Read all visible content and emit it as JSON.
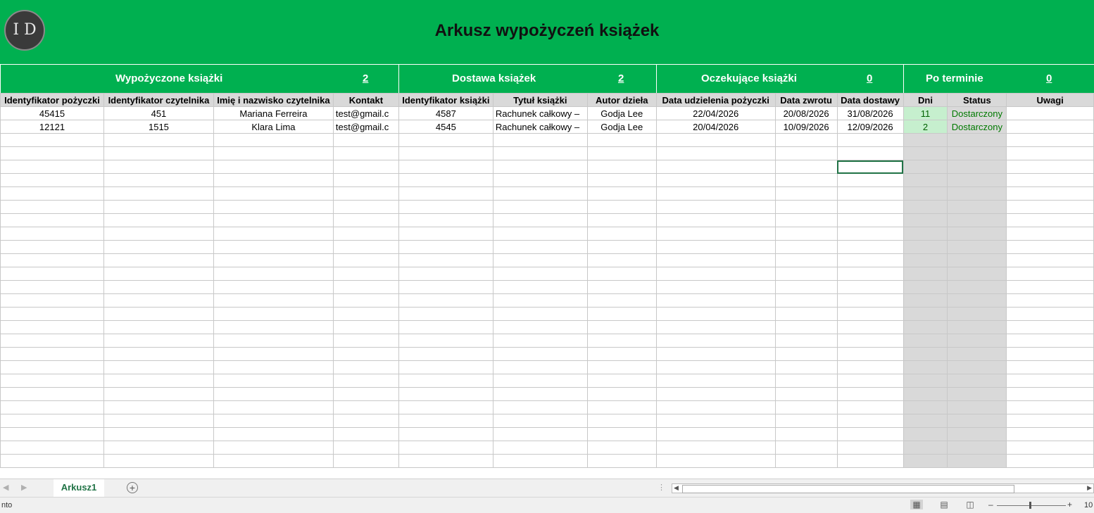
{
  "banner": {
    "logo_text": "I D",
    "title": "Arkusz wypożyczeń książek"
  },
  "stats": [
    {
      "label": "Wypożyczone książki",
      "value": "2"
    },
    {
      "label": "Dostawa książek",
      "value": "2"
    },
    {
      "label": "Oczekujące książki",
      "value": "0"
    },
    {
      "label": "Po terminie",
      "value": "0"
    }
  ],
  "table": {
    "headers": [
      "Identyfikator pożyczki",
      "Identyfikator czytelnika",
      "Imię i nazwisko czytelnika",
      "Kontakt",
      "Identyfikator książki",
      "Tytuł książki",
      "Autor dzieła",
      "Data udzielenia pożyczki",
      "Data zwrotu",
      "Data dostawy",
      "Dni",
      "Status",
      "Uwagi"
    ],
    "rows": [
      [
        "45415",
        "451",
        "Mariana Ferreira",
        "test@gmail.c",
        "4587",
        "Rachunek całkowy –",
        "Godja Lee",
        "22/04/2026",
        "20/08/2026",
        "31/08/2026",
        "11",
        "Dostarczony",
        ""
      ],
      [
        "12121",
        "1515",
        "Klara Lima",
        "test@gmail.c",
        "4545",
        "Rachunek całkowy –",
        "Godja Lee",
        "20/04/2026",
        "10/09/2026",
        "12/09/2026",
        "2",
        "Dostarczony",
        ""
      ]
    ]
  },
  "sheet_tab": "Arkusz1",
  "status_text": "nto",
  "zoom_text": "10",
  "colors": {
    "banner": "#00b050",
    "accent": "#217346",
    "status_green": "#c6efce"
  }
}
